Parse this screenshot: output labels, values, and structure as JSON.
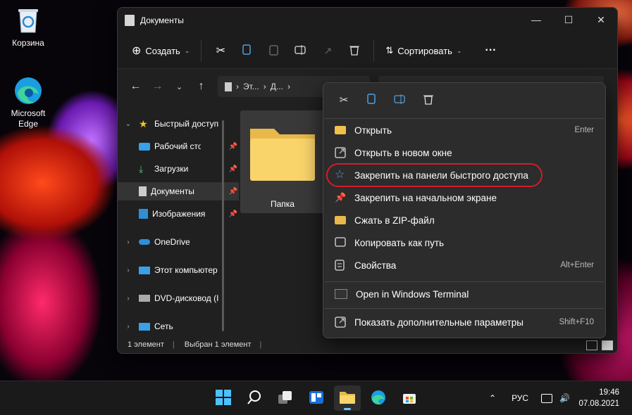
{
  "desktop": {
    "icons": [
      {
        "label": "Корзина"
      },
      {
        "label": "Microsoft Edge"
      }
    ]
  },
  "window": {
    "title": "Документы",
    "toolbar": {
      "create_label": "Создать",
      "sort_label": "Сортировать",
      "more_label": "···"
    },
    "address": {
      "crumb1": "Эт...",
      "crumb2": "Д..."
    },
    "sidebar": {
      "items": [
        {
          "label": "Быстрый доступ",
          "expanded": true
        },
        {
          "label": "Рабочий стол"
        },
        {
          "label": "Загрузки"
        },
        {
          "label": "Документы",
          "selected": true
        },
        {
          "label": "Изображения"
        },
        {
          "label": "OneDrive"
        },
        {
          "label": "Этот компьютер"
        },
        {
          "label": "DVD-дисковод (I"
        },
        {
          "label": "Сеть"
        }
      ]
    },
    "content": {
      "folder_label": "Папка"
    },
    "status": {
      "count": "1 элемент",
      "selected": "Выбран 1 элемент"
    }
  },
  "context_menu": {
    "items": [
      {
        "label": "Открыть",
        "shortcut": "Enter",
        "icon": "folder-open-icon"
      },
      {
        "label": "Открыть в новом окне",
        "shortcut": "",
        "icon": "new-window-icon"
      },
      {
        "label": "Закрепить на панели быстрого доступа",
        "shortcut": "",
        "icon": "star-icon",
        "highlighted": true
      },
      {
        "label": "Закрепить на начальном экране",
        "shortcut": "",
        "icon": "pin-icon"
      },
      {
        "label": "Сжать в ZIP-файл",
        "shortcut": "",
        "icon": "zip-icon"
      },
      {
        "label": "Копировать как путь",
        "shortcut": "",
        "icon": "copy-path-icon"
      },
      {
        "label": "Свойства",
        "shortcut": "Alt+Enter",
        "icon": "properties-icon"
      },
      {
        "label": "Open in Windows Terminal",
        "shortcut": "",
        "icon": "terminal-icon"
      },
      {
        "label": "Показать дополнительные параметры",
        "shortcut": "Shift+F10",
        "icon": "more-options-icon"
      }
    ],
    "highlight_color": "#d11d28"
  },
  "taskbar": {
    "language": "РУС",
    "time": "19:46",
    "date": "07.08.2021",
    "accent": "#60cdff"
  }
}
